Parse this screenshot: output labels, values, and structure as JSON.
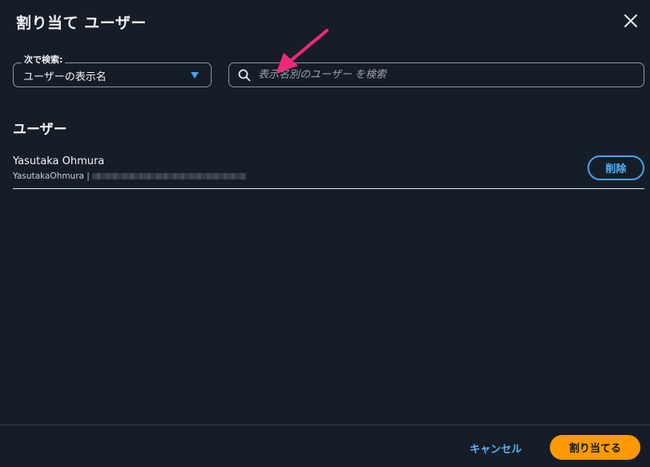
{
  "dialog": {
    "title": "割り当て ユーザー",
    "close_icon": "close-icon"
  },
  "search": {
    "search_by_label": "次で検索:",
    "search_by_value": "ユーザーの表示名",
    "placeholder": "表示名別のユーザー を検索",
    "search_icon": "search-icon"
  },
  "section": {
    "heading": "ユーザー"
  },
  "users": [
    {
      "display_name": "Yasutaka Ohmura",
      "username": "YasutakaOhmura |",
      "delete_label": "削除"
    }
  ],
  "footer": {
    "cancel_label": "キャンセル",
    "assign_label": "割り当てる"
  },
  "colors": {
    "background": "#161d28",
    "accent_blue": "#42a5f5",
    "primary_orange": "#ff9900",
    "annotation_arrow": "#f0287a"
  }
}
